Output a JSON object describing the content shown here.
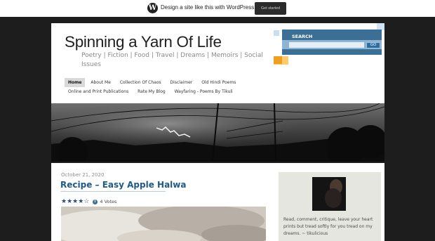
{
  "wpbar": {
    "logo": "W",
    "promo": "Design a site like this with WordPress.com",
    "cta": "Get started"
  },
  "site": {
    "title": "Spinning a Yarn Of Life",
    "tagline": "Poetry | Fiction | Food | Travel | Dreams | Memoirs | Social Issues"
  },
  "nav": {
    "row1": [
      "Home",
      "About Me",
      "Collection Of Chaos",
      "Disclaimer",
      "Old Hindi Poems"
    ],
    "row2": [
      "Online and Print Publications",
      "Rate My Blog",
      "Wayfaring - Poems By Tikuli"
    ]
  },
  "search": {
    "label": "SEARCH",
    "placeholder": "",
    "button": "GO"
  },
  "post": {
    "date": "October 21, 2020",
    "title": "Recipe – Easy Apple Halwa",
    "stars": "★★★★☆",
    "rating": 3.5,
    "info_icon": "i",
    "votes": "4 Votes"
  },
  "sidebar": {
    "quote": "Read, comment, critique, leave your heart prints but tread softly for you tread on my dreams. ~ tikulicious"
  },
  "colors": {
    "title_blue": "#1e5a86",
    "search_blue": "#3c6f96",
    "accent_orange": "#f0a020"
  }
}
